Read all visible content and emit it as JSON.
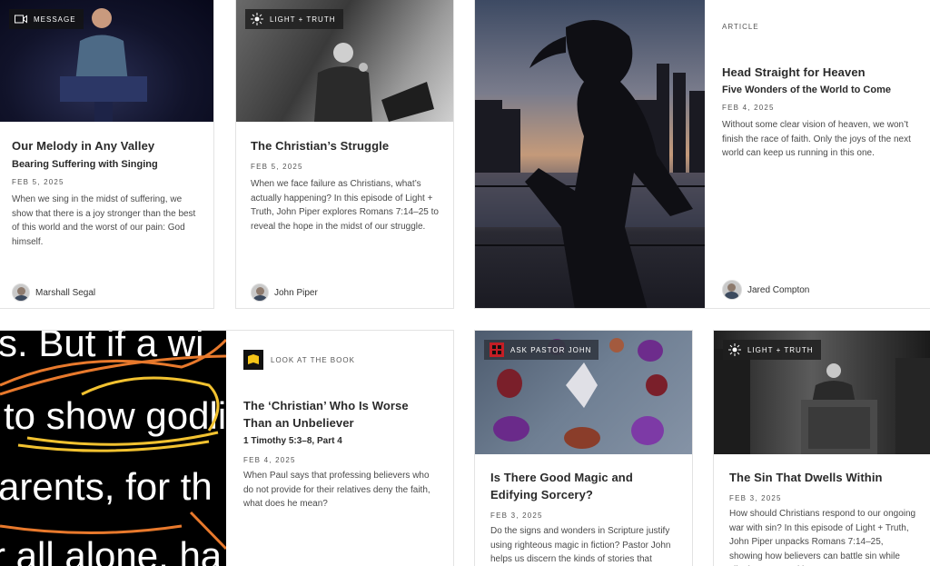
{
  "cards": [
    {
      "tag": "MESSAGE",
      "title": "Our Melody in Any Valley",
      "subtitle": "Bearing Suffering with Singing",
      "date": "FEB 5, 2025",
      "excerpt": "When we sing in the midst of suffering, we show that there is a joy stronger than the best of this world and the worst of our pain: God himself.",
      "author": "Marshall Segal"
    },
    {
      "tag": "LIGHT + TRUTH",
      "title": "The Christian’s Struggle",
      "date": "FEB 5, 2025",
      "excerpt": "When we face failure as Christians, what’s actually happening? In this episode of Light + Truth, John Piper explores Romans 7:14–25 to reveal the hope in the midst of our struggle.",
      "author": "John Piper"
    },
    {
      "tag": "ARTICLE",
      "title": "Head Straight for Heaven",
      "subtitle": "Five Wonders of the World to Come",
      "date": "FEB 4, 2025",
      "excerpt": "Without some clear vision of heaven, we won’t finish the race of faith. Only the joys of the next world can keep us running in this one.",
      "author": "Jared Compton"
    },
    {
      "tag": "LOOK AT THE BOOK",
      "title": "The ‘Christian’ Who Is Worse Than an Unbeliever",
      "subtitle": "1 Timothy 5:3–8, Part 4",
      "date": "FEB 4, 2025",
      "excerpt": "When Paul says that professing believers who do not provide for their relatives deny the faith, what does he mean?",
      "image_text": [
        "s. But if a wi",
        "to show godli",
        "arents, for th",
        "r all alone, ha"
      ]
    },
    {
      "tag": "ASK PASTOR JOHN",
      "title": "Is There Good Magic and Edifying Sorcery?",
      "date": "FEB 3, 2025",
      "excerpt": "Do the signs and wonders in Scripture justify using righteous magic in fiction? Pastor John helps us discern the kinds of stories that"
    },
    {
      "tag": "LIGHT + TRUTH",
      "title": "The Sin That Dwells Within",
      "date": "FEB 3, 2025",
      "excerpt": "How should Christians respond to our ongoing war with sin? In this episode of Light + Truth, John Piper unpacks Romans 7:14–25, showing how believers can battle sin while clinging to gospel hope."
    }
  ]
}
